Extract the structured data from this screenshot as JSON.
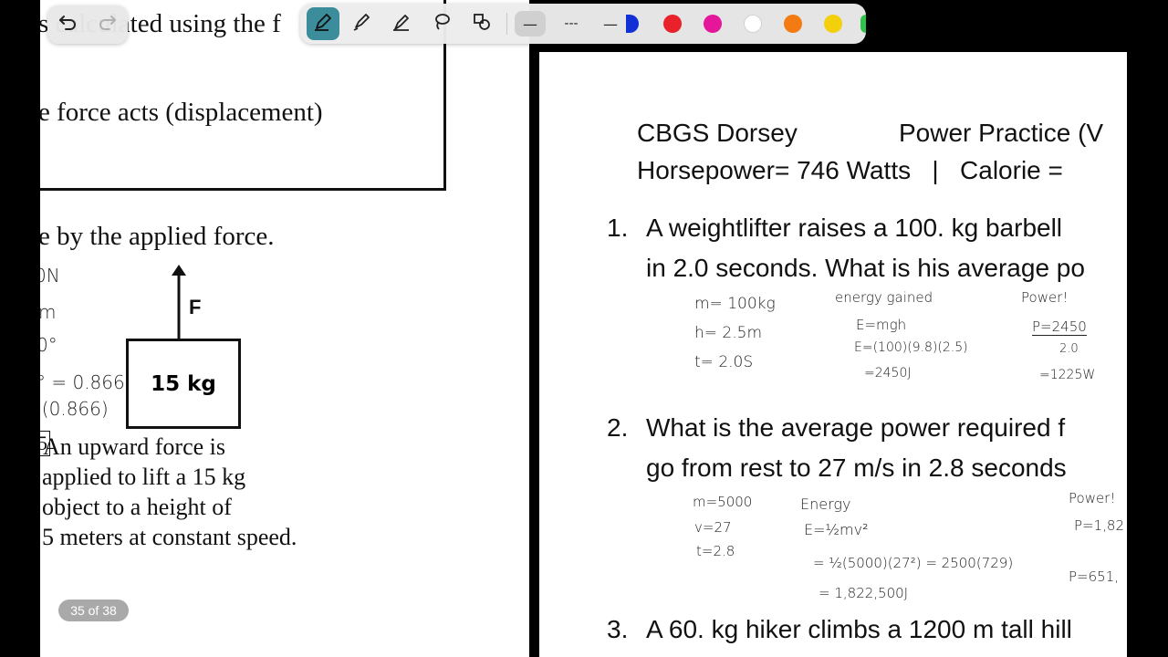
{
  "left_page": {
    "text_top": "s calculated using the f",
    "text_force_acts": "e force acts (displacement)",
    "text_by_force": "e by the applied force.",
    "given_partial": [
      "0N",
      "m",
      "0°",
      "° = 0.866",
      ")(0.866)"
    ],
    "box_label": "15 kg",
    "arrow_label": "F",
    "problem_prefix": "5",
    "problem_lines": [
      "An upward force is",
      "applied to lift a 15 kg",
      "object to a height of",
      "5 meters at constant speed."
    ],
    "page_indicator": "35 of 38"
  },
  "right_page": {
    "header_left": "CBGS Dorsey",
    "header_right": "Power Practice (V",
    "header_line2": "Horsepower= 746 Watts   |   Calorie =",
    "q1_num": "1.",
    "q1_line1": "A weightlifter raises a 100. kg barbell",
    "q1_line2": "in 2.0 seconds. What is his average po",
    "q1_work": {
      "givens": [
        "m= 100kg",
        "h= 2.5m",
        "t= 2.0S"
      ],
      "energy_title": "energy gained",
      "energy_lines": [
        "E=mgh",
        "E=(100)(9.8)(2.5)",
        "=2450J"
      ],
      "power_title": "Power!",
      "power_lines": [
        "P=2450",
        "2.0",
        "=1225W"
      ]
    },
    "q2_num": "2.",
    "q2_line1": "What is the average power required f",
    "q2_line2": "go from rest to 27 m/s in 2.8 seconds",
    "q2_work": {
      "givens": [
        "m=5000",
        "v=27",
        "t=2.8"
      ],
      "energy_title": "Energy",
      "energy_lines": [
        "E=½mv²",
        "= ½(5000)(27²) = 2500(729)",
        "= 1,822,500J"
      ],
      "power_title": "Power!",
      "power_lines": [
        "P=1,82",
        "P=651,"
      ]
    },
    "q3_num": "3.",
    "q3_line1": "A 60. kg hiker climbs a 1200 m tall hill"
  },
  "toolbar": {
    "undo_icon": "undo-icon",
    "redo_icon": "redo-icon",
    "tools": [
      "pen-icon",
      "highlighter-icon",
      "pencil-icon",
      "lasso-icon",
      "shapes-icon"
    ],
    "line_styles": [
      "—",
      "---",
      "—"
    ],
    "colors": [
      "#1230d6",
      "#e8212a",
      "#e5169a",
      "#ffffff",
      "#f47a12",
      "#f3cf0c",
      "#2fc34a"
    ],
    "accent": "#3c8d9c"
  }
}
